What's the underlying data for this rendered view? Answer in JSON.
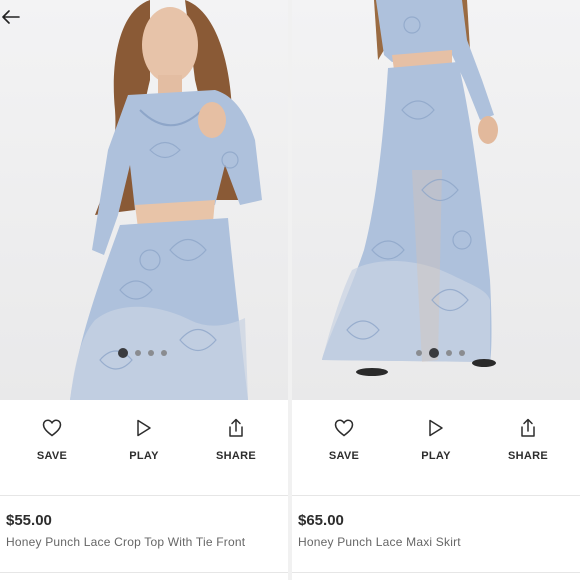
{
  "colors": {
    "lace": "#aec1dc",
    "lace_dark": "#8ea6c9",
    "dot_inactive": "#8a8c90",
    "dot_active": "#3a3b3e",
    "text_dark": "#2d2d2d",
    "text_muted": "#666666"
  },
  "icons": {
    "back": "arrow-left-icon",
    "save": "heart-outline-icon",
    "play": "play-triangle-icon",
    "share": "share-upload-icon"
  },
  "carousel": {
    "left": {
      "slides": 4,
      "active_index": 0
    },
    "right": {
      "slides": 4,
      "active_index": 1
    }
  },
  "products": [
    {
      "actions": {
        "save_label": "SAVE",
        "play_label": "PLAY",
        "share_label": "SHARE"
      },
      "price": "$55.00",
      "name": "Honey Punch Lace Crop Top With Tie Front"
    },
    {
      "actions": {
        "save_label": "SAVE",
        "play_label": "PLAY",
        "share_label": "SHARE"
      },
      "price": "$65.00",
      "name": "Honey Punch Lace Maxi Skirt"
    }
  ]
}
